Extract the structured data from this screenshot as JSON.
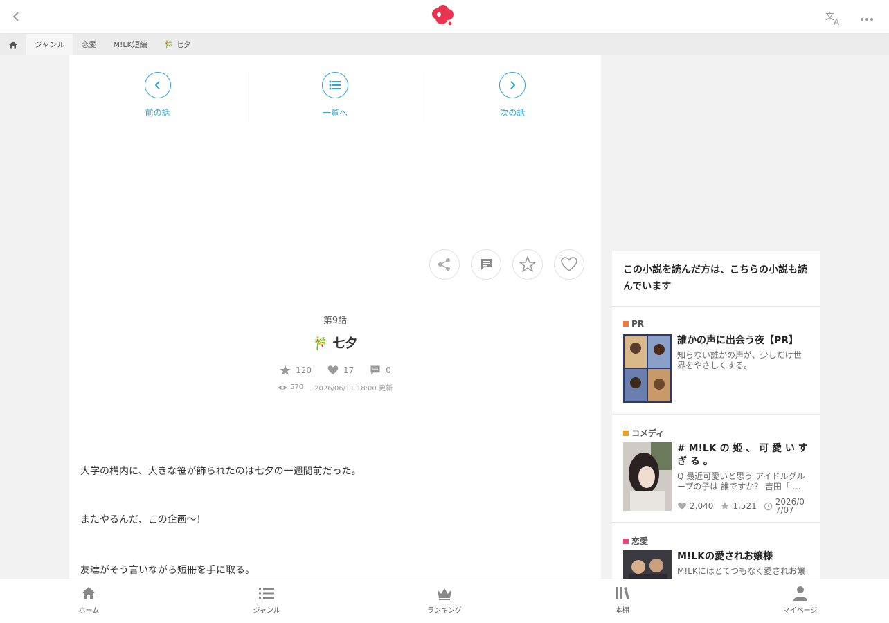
{
  "breadcrumb": [
    "ジャンル",
    "恋愛",
    "M!LK短編",
    "🎋 七夕"
  ],
  "nav": {
    "prev_label": "前の話",
    "list_label": "一覧へ",
    "next_label": "次の話"
  },
  "episode": {
    "number": "第9話",
    "title": "🎋 七夕",
    "stars": "120",
    "hearts": "17",
    "comments": "0",
    "views": "570",
    "updated": "2026/06/11 18:00 更新"
  },
  "body": [
    "大学の構内に、大きな笹が飾られたのは七夕の一週間前だった。",
    "またやるんだ、この企画〜！",
    "友達がそう言いながら短冊を手に取る。"
  ],
  "sidebar": {
    "heading": "この小説を読んだ方は、こちらの小説も読んでいます",
    "cards": [
      {
        "genre": "PR",
        "genre_color": "#f07a3a",
        "title": "誰かの声に出会う夜【PR】",
        "desc": "知らない誰かの声が、少しだけ世界をやさしくする。"
      },
      {
        "genre": "コメディ",
        "genre_color": "#f0a020",
        "title": "# M!LK の 姫 、 可 愛 い す ぎ る 。",
        "desc": "Q 最近可愛いと思う アイドルグループの子は 誰ですか？ 吉田「 …",
        "hearts": "2,040",
        "stars": "1,521",
        "date": "2026/07/07"
      },
      {
        "genre": "恋愛",
        "genre_color": "#e8457a",
        "title": "M!LKの愛されお嬢様",
        "desc": "M!LKにはとてつもなく愛されお嬢"
      }
    ]
  },
  "bottom_nav": [
    "ホーム",
    "ジャンル",
    "ランキング",
    "本棚",
    "マイページ"
  ],
  "colors": {
    "accent": "#2aa6d6",
    "brand": "#e8344e"
  }
}
